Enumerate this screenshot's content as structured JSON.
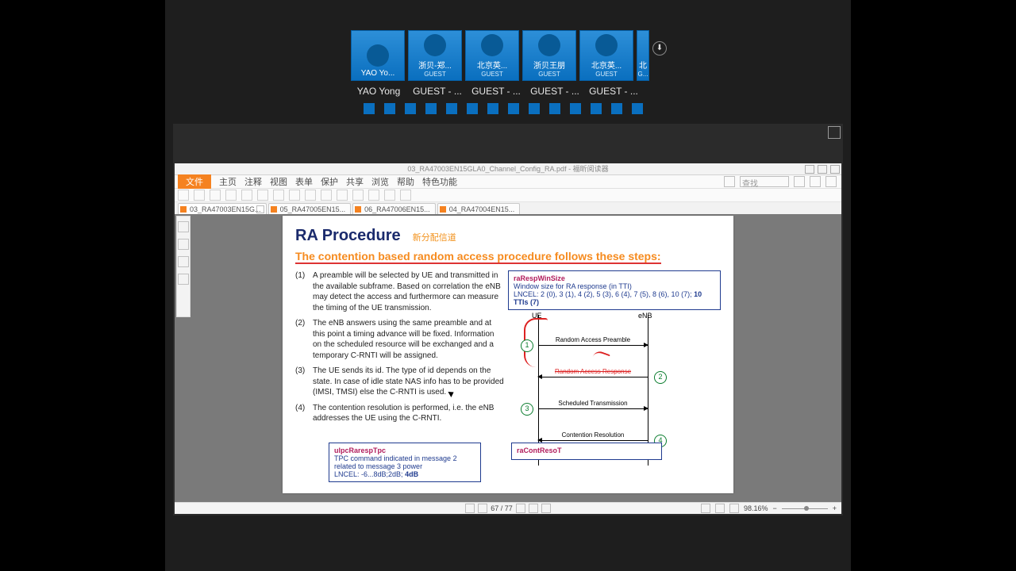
{
  "participants": {
    "tiles": [
      {
        "name": "YAO Yo...",
        "guest": ""
      },
      {
        "name": "浙贝-郑...",
        "guest": "GUEST"
      },
      {
        "name": "北京英...",
        "guest": "GUEST"
      },
      {
        "name": "浙贝王朋",
        "guest": "GUEST"
      },
      {
        "name": "北京英...",
        "guest": "GUEST"
      },
      {
        "name": "北",
        "guest": "G..."
      }
    ],
    "labels": [
      "YAO Yong",
      "GUEST - ...",
      "GUEST - ...",
      "GUEST - ...",
      "GUEST - ..."
    ],
    "mini_count": 14,
    "down_glyph": "⬇"
  },
  "pdf": {
    "window_title": "03_RA47003EN15GLA0_Channel_Config_RA.pdf - 福昕阅读器",
    "menubar": {
      "file": "文件",
      "items": [
        "主页",
        "注释",
        "视图",
        "表单",
        "保护",
        "共享",
        "浏览",
        "帮助",
        "特色功能"
      ],
      "search_placeholder": "查找"
    },
    "tabs": [
      {
        "label": "03_RA47003EN15G...",
        "active": true,
        "closable": true
      },
      {
        "label": "05_RA47005EN15...",
        "active": false,
        "closable": false
      },
      {
        "label": "06_RA47006EN15...",
        "active": false,
        "closable": false
      },
      {
        "label": "04_RA47004EN15...",
        "active": false,
        "closable": false
      }
    ],
    "status": {
      "page": "67 / 77",
      "zoom": "98.16%"
    }
  },
  "doc": {
    "title": "RA Procedure",
    "subtitle_zh": "新分配信道",
    "heading": "The contention based random access procedure follows these steps:",
    "steps": [
      {
        "n": "(1)",
        "t": "A preamble will be selected by UE and transmitted in the available subframe. Based on correlation the eNB may detect the access and furthermore can measure the timing of the UE transmission."
      },
      {
        "n": "(2)",
        "t": "The eNB answers using the same preamble and at this point a timing advance will be fixed. Information on the scheduled resource will be exchanged and a temporary C-RNTI will be assigned."
      },
      {
        "n": "(3)",
        "t": "The UE sends its id. The type of id depends on the state. In case of idle state NAS info has to be provided (IMSI, TMSI) else the C-RNTI is used."
      },
      {
        "n": "(4)",
        "t": "The contention resolution is performed, i.e. the eNB addresses the UE using the C-RNTI."
      }
    ],
    "box_raResp": {
      "key": "raRespWinSize",
      "l1": "Window size for RA response (in TTI)",
      "l2": "LNCEL: 2 (0), 3 (1), 4 (2), 5 (3), 6 (4), 7 (5), 8 (6), 10 (7);",
      "l2b": "10 TTIs (7)"
    },
    "seq": {
      "ue": "UE",
      "enb": "eNB",
      "m1": "Random Access Preamble",
      "m2": "Random Access Response",
      "m3": "Scheduled Transmission",
      "m4": "Contention Resolution"
    },
    "box_ulpc": {
      "key": "ulpcRarespTpc",
      "l1": "TPC command indicated in message 2 related to message 3 power",
      "l2": "LNCEL: -6...8dB;2dB;",
      "l2b": "4dB"
    },
    "box_raCont": {
      "key": "raContResoT"
    }
  }
}
